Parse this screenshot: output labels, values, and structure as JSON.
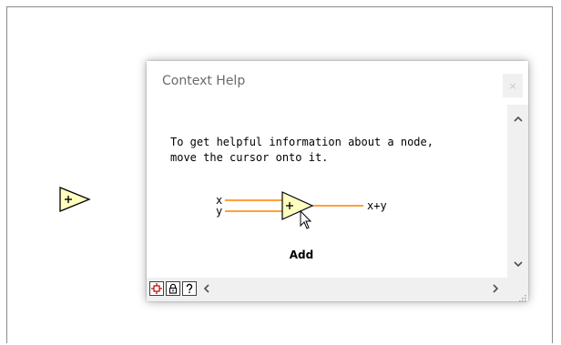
{
  "help_window": {
    "title": "Context Help",
    "close_glyph": "×",
    "message_lines": [
      "To get helpful information about a node,",
      "move the cursor onto it."
    ],
    "diagram": {
      "input_x_label": "x",
      "input_y_label": "y",
      "output_label": "x+y",
      "node_symbol": "+"
    },
    "node_name": "Add"
  },
  "colors": {
    "node_fill": "#ffffc0",
    "wire": "#ff8000",
    "text_gray": "#6b6b6b"
  },
  "icons": {
    "canvas_node": "add-node-icon",
    "show_block_diagram": "block-diagram-icon",
    "lock": "lock-icon",
    "help": "question-mark-icon"
  }
}
